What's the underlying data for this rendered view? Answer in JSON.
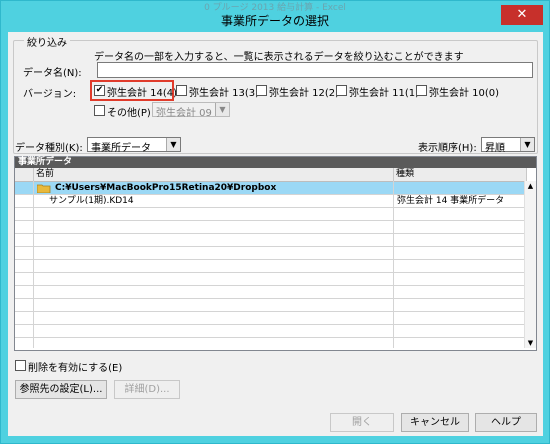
{
  "window": {
    "ghost_title": "0  プルージ  2013   給与計算 - Excel",
    "title": "事業所データの選択",
    "close": "✕"
  },
  "filter": {
    "group_label": "絞り込み",
    "hint": "データ名の一部を入力すると、一覧に表示されるデータを絞り込むことができます",
    "data_name_label": "データ名(N):",
    "data_name_value": "",
    "version_label": "バージョン:",
    "versions": [
      {
        "label": "弥生会計 14(4)",
        "checked": true
      },
      {
        "label": "弥生会計 13(3)",
        "checked": false
      },
      {
        "label": "弥生会計 12(2)",
        "checked": false
      },
      {
        "label": "弥生会計 11(1)",
        "checked": false
      },
      {
        "label": "弥生会計 10(0)",
        "checked": false
      }
    ],
    "other_label": "その他(P)",
    "other_checked": false,
    "other_select": "弥生会計 09"
  },
  "options": {
    "data_type_label": "データ種別(K):",
    "data_type_value": "事業所データ",
    "sort_label": "表示順序(H):",
    "sort_value": "昇順"
  },
  "list": {
    "header": "事業所データ",
    "columns": [
      "名前",
      "種類"
    ],
    "folder_row": "C:¥Users¥MacBookPro15Retina20¥Dropbox",
    "rows": [
      {
        "name": "サンプル(1期).KD14",
        "type": "弥生会計 14 事業所データ"
      }
    ]
  },
  "enable_delete": {
    "label": "削除を有効にする(E)",
    "checked": false
  },
  "buttons": {
    "ref_settings": "参照先の設定(L)...",
    "detail": "詳細(D)...",
    "open": "開く",
    "cancel": "キャンセル",
    "help": "ヘルプ"
  },
  "icons": {
    "checkbox_checked": "✔",
    "dropdown": "▼",
    "folder": "folder-icon"
  }
}
